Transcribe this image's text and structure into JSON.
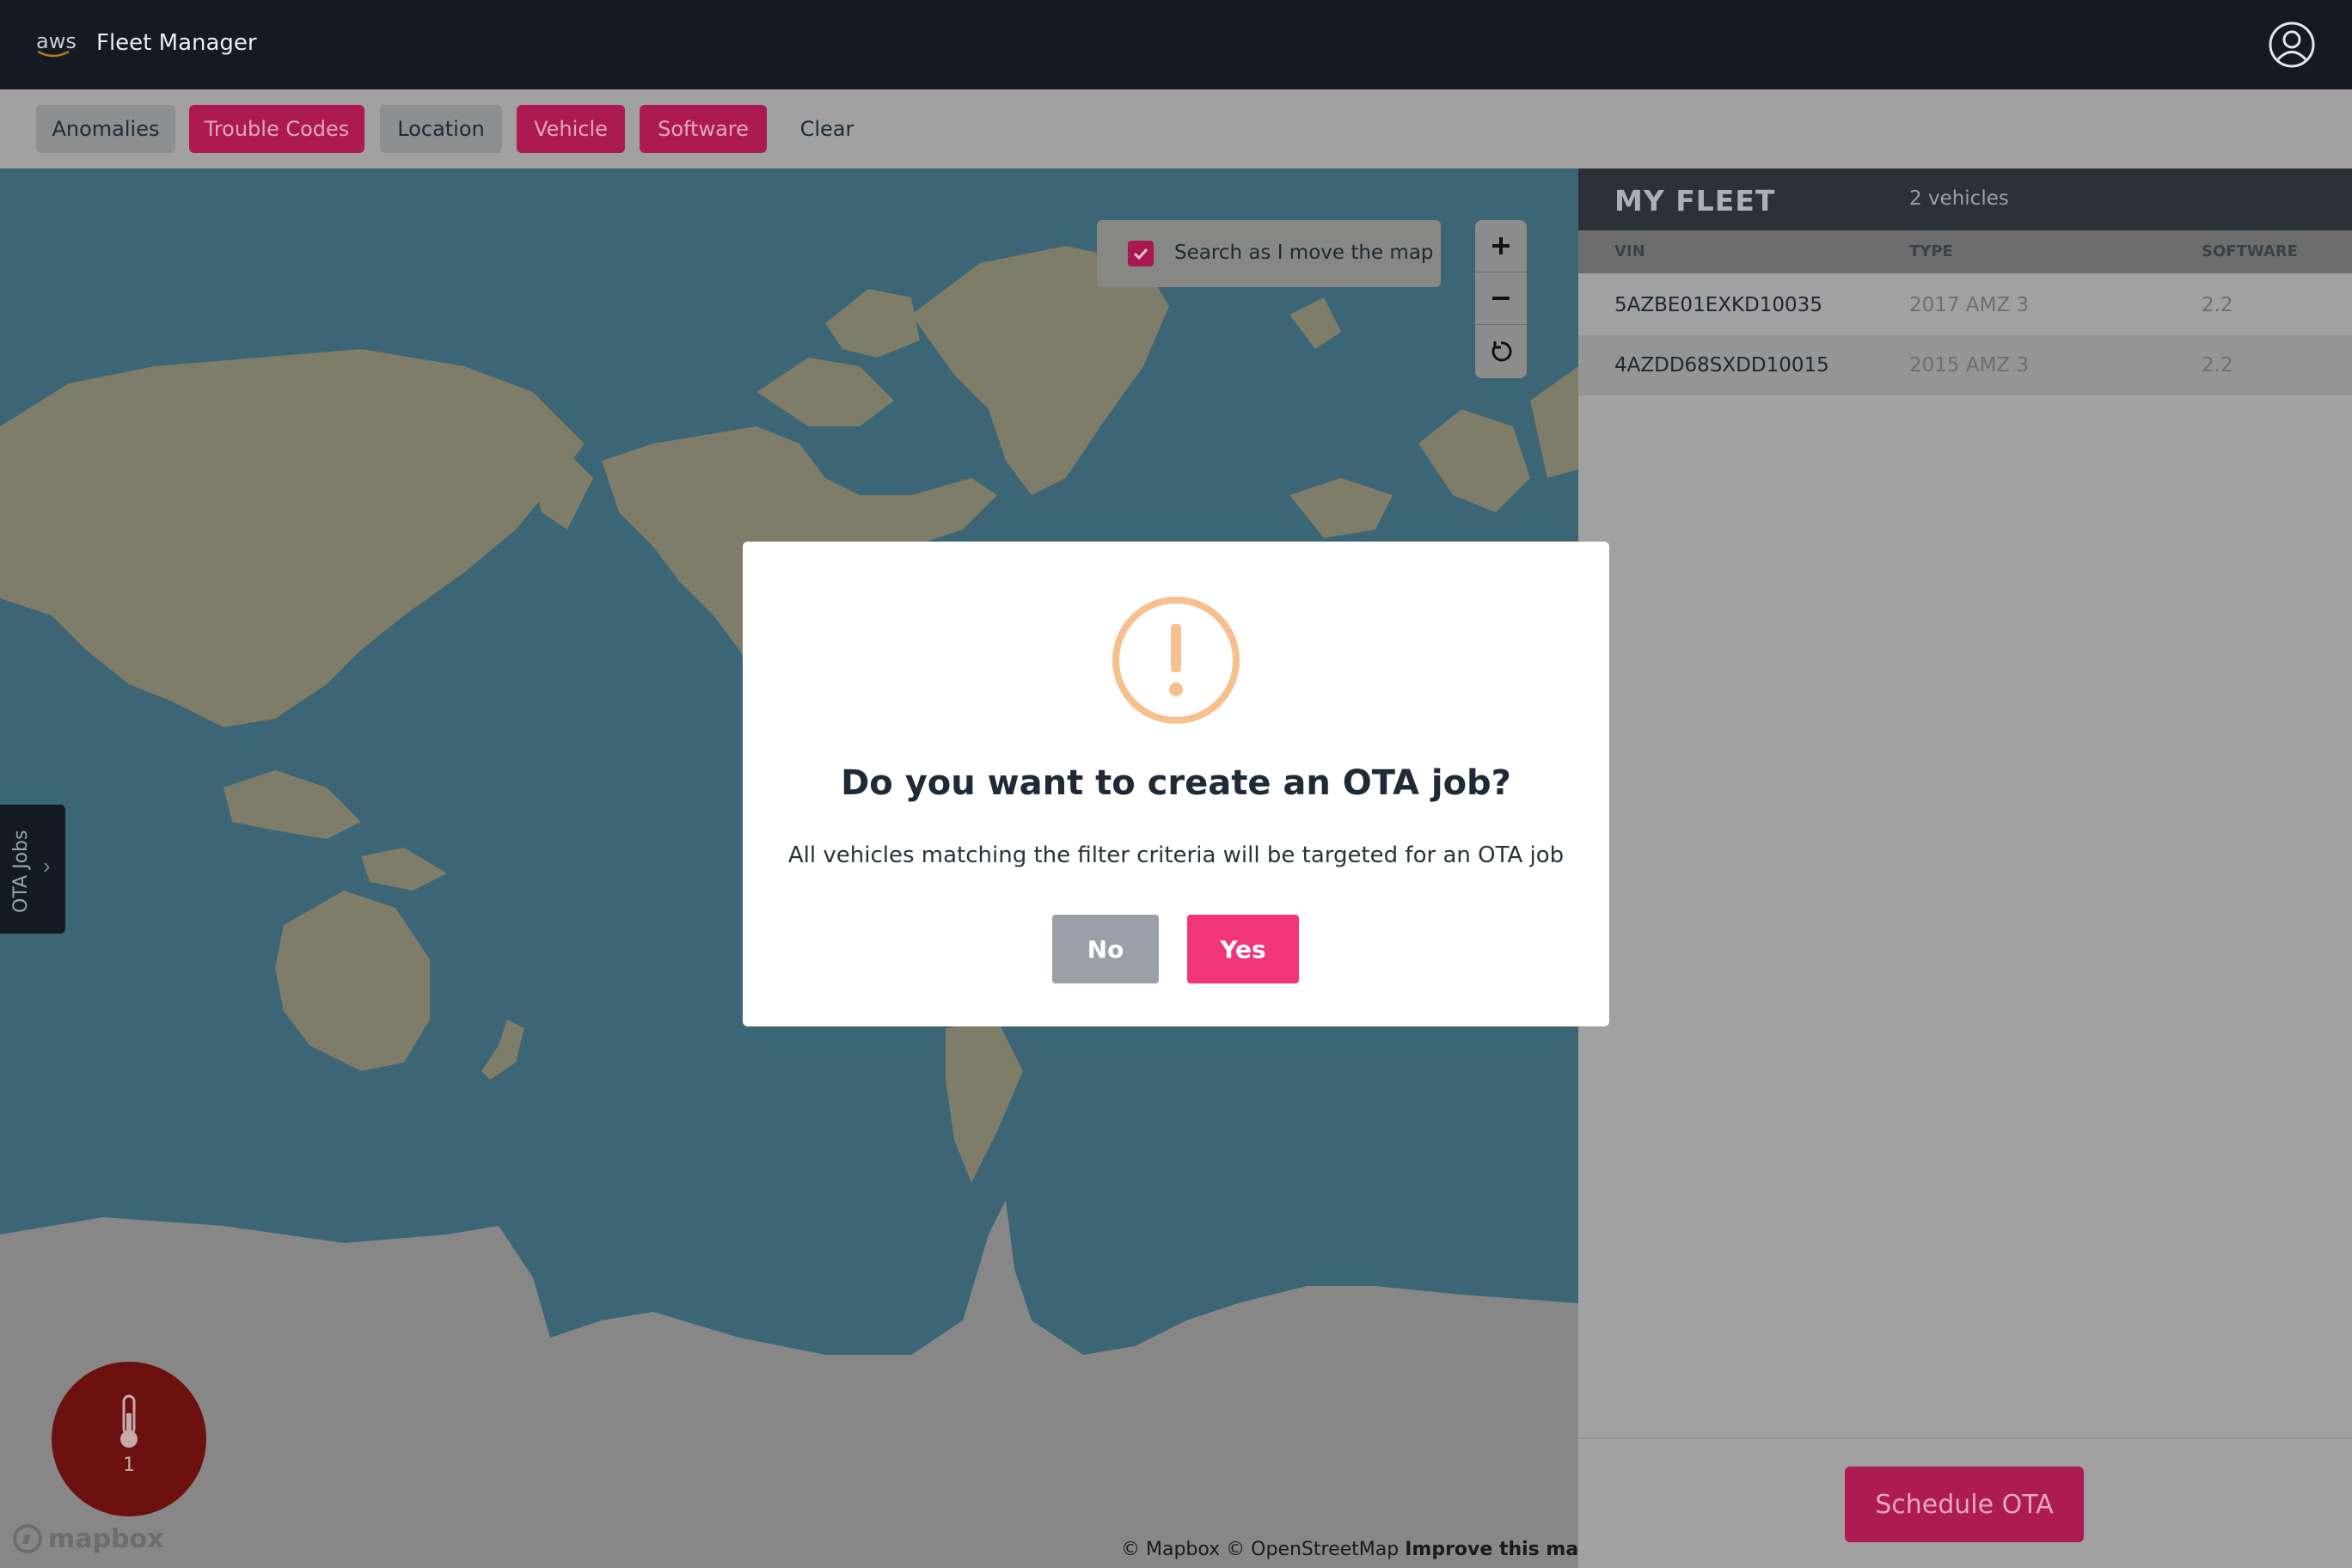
{
  "header": {
    "logo_text": "aws",
    "app_title": "Fleet Manager",
    "profile_icon": "user-circle-icon"
  },
  "filters": [
    {
      "label": "Anomalies",
      "active": false
    },
    {
      "label": "Trouble Codes",
      "active": true
    },
    {
      "label": "Location",
      "active": false
    },
    {
      "label": "Vehicle",
      "active": true
    },
    {
      "label": "Software",
      "active": true
    },
    {
      "label": "Clear",
      "active": false
    }
  ],
  "map": {
    "search_checkbox_checked": true,
    "search_label": "Search as I move the map",
    "zoom_in_icon": "plus-icon",
    "zoom_out_icon": "minus-icon",
    "reset_icon": "rotate-icon",
    "ota_tab_label": "OTA Jobs",
    "alert_count": "1",
    "mapbox_logo": "mapbox",
    "attribution": "© Mapbox © OpenStreetMap",
    "improve_link": "Improve this map"
  },
  "fleet": {
    "title": "MY FLEET",
    "count": "2 vehicles",
    "columns": {
      "vin": "VIN",
      "type": "TYPE",
      "software": "SOFTWARE"
    },
    "rows": [
      {
        "vin": "5AZBE01EXKD10035",
        "type": "2017 AMZ 3",
        "software": "2.2"
      },
      {
        "vin": "4AZDD68SXDD10015",
        "type": "2015 AMZ 3",
        "software": "2.2"
      }
    ],
    "schedule_button": "Schedule OTA"
  },
  "modal": {
    "icon": "warning-icon",
    "title": "Do you want to create an OTA job?",
    "text": "All vehicles matching the filter criteria will be targeted for an OTA job",
    "no_label": "No",
    "yes_label": "Yes"
  },
  "colors": {
    "accent_pink": "#ae1a53",
    "yes_button": "#f2357a",
    "warning_icon": "#f8c08f",
    "topbar": "#131a22"
  }
}
